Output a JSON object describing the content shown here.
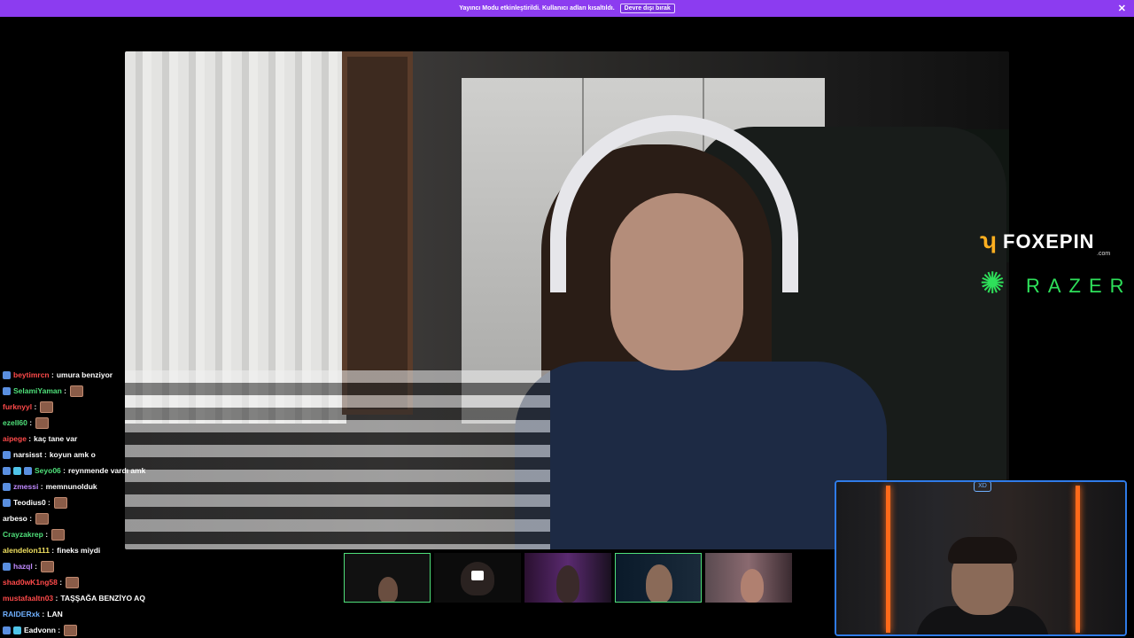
{
  "notice": {
    "text": "Yayıncı Modu etkinleştirildi. Kullanıcı adları kısaltıldı.",
    "button_label": "Devre dışı bırak",
    "close_symbol": "✕"
  },
  "sponsors": {
    "foxepin_text": "FOXEPIN",
    "foxepin_sub": ".com",
    "razer_text": "RAZER",
    "foxepin_color": "#ffb020",
    "razer_color": "#2ee05a"
  },
  "chat": [
    {
      "user": "beytimrcn",
      "color": "#ff4a4a",
      "msg": "umura benziyor",
      "badges": 1,
      "emote": false
    },
    {
      "user": "SelamiYaman",
      "color": "#4fe07a",
      "msg": "",
      "badges": 1,
      "emote": true
    },
    {
      "user": "furknyyl",
      "color": "#ff4a4a",
      "msg": "",
      "badges": 0,
      "emote": true
    },
    {
      "user": "ezell60",
      "color": "#4fe07a",
      "msg": "",
      "badges": 0,
      "emote": true
    },
    {
      "user": "aipege",
      "color": "#ff4a4a",
      "msg": "kaç tane var",
      "badges": 0,
      "emote": false
    },
    {
      "user": "narsisst",
      "color": "#ffffff",
      "msg": "koyun amk o",
      "badges": 1,
      "emote": false
    },
    {
      "user": "Seyo06",
      "color": "#4fe07a",
      "msg": "reynmende vardı amk",
      "badges": 3,
      "emote": false
    },
    {
      "user": "zmessi",
      "color": "#c08aff",
      "msg": "memnunolduk",
      "badges": 1,
      "emote": false
    },
    {
      "user": "Teodius0",
      "color": "#ffffff",
      "msg": "",
      "badges": 1,
      "emote": true
    },
    {
      "user": "arbeso",
      "color": "#ffffff",
      "msg": "",
      "badges": 0,
      "emote": true
    },
    {
      "user": "Crayzakrep",
      "color": "#4fe07a",
      "msg": "",
      "badges": 0,
      "emote": true
    },
    {
      "user": "alendelon111",
      "color": "#f0e060",
      "msg": "fineks miydi",
      "badges": 0,
      "emote": false
    },
    {
      "user": "hazql",
      "color": "#c08aff",
      "msg": "",
      "badges": 1,
      "emote": true
    },
    {
      "user": "shad0wK1ng58",
      "color": "#ff4a4a",
      "msg": "",
      "badges": 0,
      "emote": true
    },
    {
      "user": "mustafaaltn03",
      "color": "#ff4a4a",
      "msg": "TAŞŞAĞA BENZİYO AQ",
      "badges": 0,
      "emote": false
    },
    {
      "user": "RAIDERxk",
      "color": "#6fb0ff",
      "msg": "LAN",
      "badges": 0,
      "emote": false
    },
    {
      "user": "Eadvonn",
      "color": "#ffffff",
      "msg": "",
      "badges": 2,
      "emote": true
    }
  ],
  "thumbnails": [
    {
      "name": "thumb-1",
      "active": true
    },
    {
      "name": "thumb-2-camera-off",
      "active": false
    },
    {
      "name": "thumb-3",
      "active": false
    },
    {
      "name": "thumb-4",
      "active": true
    },
    {
      "name": "thumb-5",
      "active": false
    }
  ],
  "overlay": {
    "logo_text": "XD",
    "frame_color": "#2f7be8",
    "neon_color": "#ff6a1a"
  }
}
